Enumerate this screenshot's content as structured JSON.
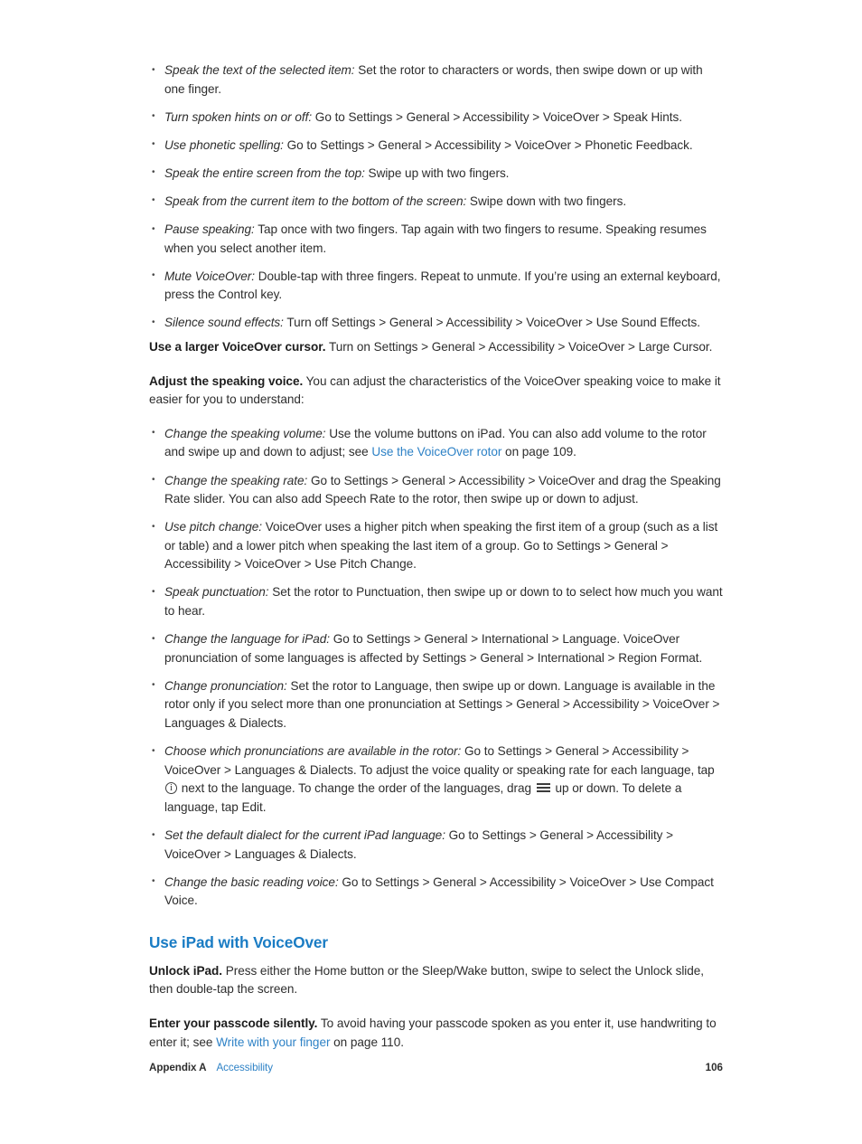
{
  "document": {
    "page_number": "106",
    "footer_appendix": "Appendix A",
    "footer_section": "Accessibility"
  },
  "colors": {
    "link": "#2e82c6",
    "heading": "#1a7cc4",
    "body_text": "#2d2d2d",
    "background": "#ffffff"
  },
  "top_bullets": [
    {
      "term": "Speak the text of the selected item:",
      "text": " Set the rotor to characters or words, then swipe down or up with one finger."
    },
    {
      "term": "Turn spoken hints on or off:",
      "text": " Go to Settings > General > Accessibility > VoiceOver > Speak Hints."
    },
    {
      "term": "Use phonetic spelling:",
      "text": " Go to Settings > General > Accessibility > VoiceOver > Phonetic Feedback."
    },
    {
      "term": "Speak the entire screen from the top:",
      "text": " Swipe up with two fingers."
    },
    {
      "term": "Speak from the current item to the bottom of the screen:",
      "text": " Swipe down with two fingers."
    },
    {
      "term": "Pause speaking:",
      "text": " Tap once with two fingers. Tap again with two fingers to resume. Speaking resumes when you select another item."
    },
    {
      "term": "Mute VoiceOver:",
      "text": " Double-tap with three fingers. Repeat to unmute. If you’re using an external keyboard, press the Control key."
    },
    {
      "term": "Silence sound effects:",
      "text": " Turn off Settings > General > Accessibility > VoiceOver > Use Sound Effects."
    }
  ],
  "para_large_cursor": {
    "lead": "Use a larger VoiceOver cursor.",
    "text": " Turn on Settings > General > Accessibility > VoiceOver > Large Cursor."
  },
  "para_adjust_voice": {
    "lead": "Adjust the speaking voice.",
    "text": " You can adjust the characteristics of the VoiceOver speaking voice to make it easier for you to understand:"
  },
  "voice_bullets": {
    "volume": {
      "term": "Change the speaking volume:",
      "text_before": " Use the volume buttons on iPad. You can also add volume to the rotor and swipe up and down to adjust; see ",
      "link": "Use the VoiceOver rotor",
      "text_after": " on page 109."
    },
    "rate": {
      "term": "Change the speaking rate:",
      "text": " Go to Settings > General > Accessibility > VoiceOver and drag the Speaking Rate slider. You can also add Speech Rate to the rotor, then swipe up or down to adjust."
    },
    "pitch": {
      "term": "Use pitch change:",
      "text": " VoiceOver uses a higher pitch when speaking the first item of a group (such as a list or table) and a lower pitch when speaking the last item of a group. Go to Settings > General > Accessibility > VoiceOver > Use Pitch Change."
    },
    "punctuation": {
      "term": "Speak punctuation:",
      "text": " Set the rotor to Punctuation, then swipe up or down to to select how much you want to hear."
    },
    "language_ipad": {
      "term": "Change the language for iPad:",
      "text": " Go to Settings > General > International > Language. VoiceOver pronunciation of some languages is affected by Settings > General > International > Region Format."
    },
    "pronunciation": {
      "term": "Change pronunciation:",
      "text": " Set the rotor to Language, then swipe up or down. Language is available in the rotor only if you select more than one pronunciation at Settings > General > Accessibility > VoiceOver > Languages & Dialects."
    },
    "choose_pronunciations": {
      "term": "Choose which pronunciations are available in the rotor:",
      "text_1": " Go to Settings > General > Accessibility > VoiceOver > Languages & Dialects. To adjust the voice quality or speaking rate for each language, tap ",
      "text_2": " next to the language. To change the order of the languages, drag ",
      "text_3": " up or down. To delete a language, tap Edit.",
      "icon_1": "info-circle-icon",
      "icon_2": "reorder-handle-icon"
    },
    "default_dialect": {
      "term": "Set the default dialect for the current iPad language:",
      "text": " Go to Settings > General > Accessibility > VoiceOver > Languages & Dialects."
    },
    "basic_reading_voice": {
      "term": "Change the basic reading voice:",
      "text": " Go to Settings > General > Accessibility > VoiceOver > Use Compact Voice."
    }
  },
  "section": {
    "heading": "Use iPad with VoiceOver",
    "unlock": {
      "lead": "Unlock iPad.",
      "text": " Press either the Home button or the Sleep/Wake button, swipe to select the Unlock slide, then double-tap the screen."
    },
    "passcode": {
      "lead": "Enter your passcode silently.",
      "text_before": " To avoid having your passcode spoken as you enter it, use handwriting to enter it; see ",
      "link": "Write with your finger",
      "text_after": " on page 110."
    }
  }
}
